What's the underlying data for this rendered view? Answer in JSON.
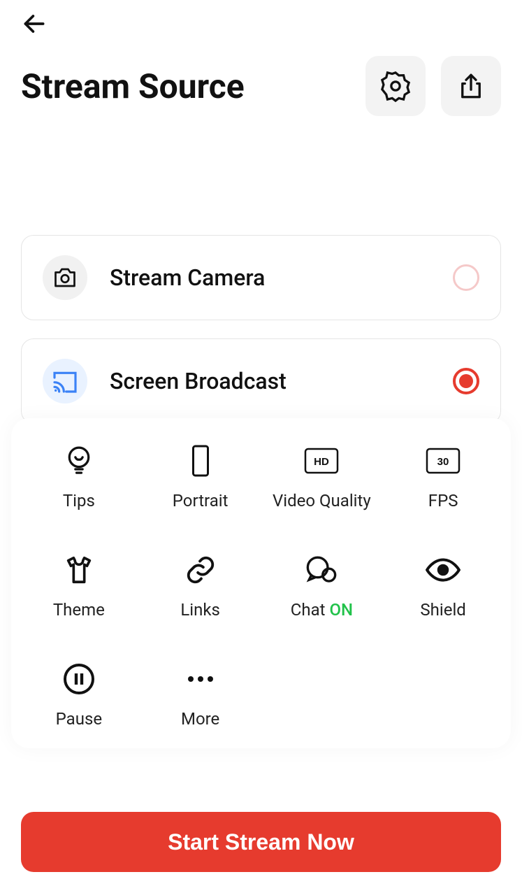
{
  "page_title": "Stream Source",
  "options": {
    "camera": {
      "label": "Stream Camera",
      "selected": false
    },
    "broadcast": {
      "label": "Screen Broadcast",
      "selected": true
    }
  },
  "grid": {
    "tips": "Tips",
    "portrait": "Portrait",
    "video_quality": "Video Quality",
    "hd_badge": "HD",
    "fps": "FPS",
    "fps_badge": "30",
    "theme": "Theme",
    "links": "Links",
    "chat": "Chat",
    "chat_state": "ON",
    "shield": "Shield",
    "pause": "Pause",
    "more": "More"
  },
  "start_button": "Start Stream Now"
}
